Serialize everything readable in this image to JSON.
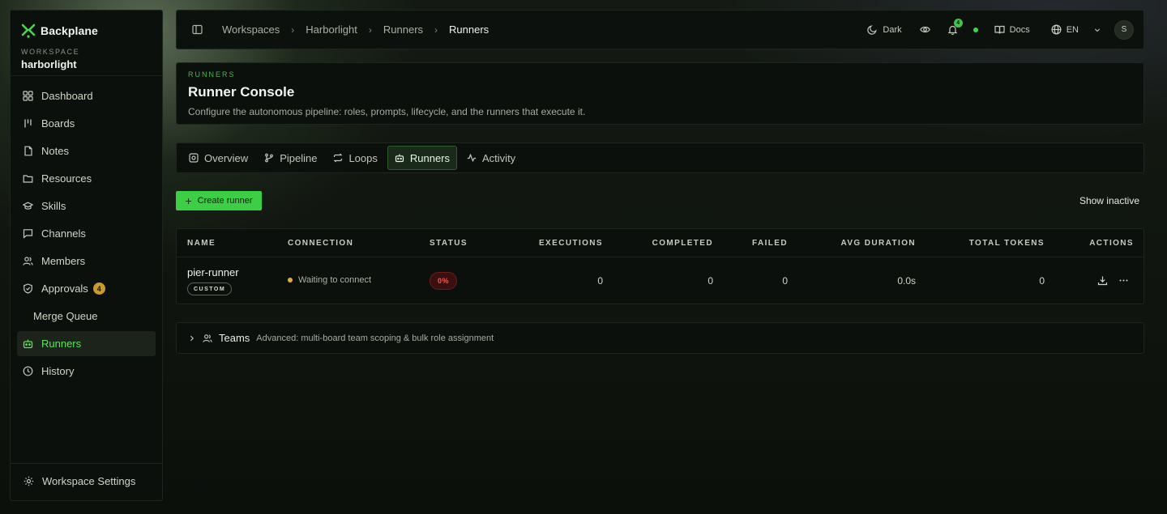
{
  "brand": {
    "name": "Backplane"
  },
  "workspace": {
    "caption": "WORKSPACE",
    "name": "harborlight"
  },
  "sidebar": {
    "items": [
      {
        "label": "Dashboard",
        "icon": "dashboard-icon"
      },
      {
        "label": "Boards",
        "icon": "boards-icon"
      },
      {
        "label": "Notes",
        "icon": "notes-icon"
      },
      {
        "label": "Resources",
        "icon": "folder-icon"
      },
      {
        "label": "Skills",
        "icon": "graduation-cap-icon"
      },
      {
        "label": "Channels",
        "icon": "chat-icon"
      },
      {
        "label": "Members",
        "icon": "users-icon"
      },
      {
        "label": "Approvals",
        "icon": "shield-icon",
        "badge": "4"
      },
      {
        "label": "Merge Queue",
        "icon": "merge-icon"
      },
      {
        "label": "Runners",
        "icon": "bot-icon",
        "active": true
      },
      {
        "label": "History",
        "icon": "clock-icon"
      }
    ],
    "settings_label": "Workspace Settings"
  },
  "breadcrumb": [
    "Workspaces",
    "Harborlight",
    "Runners",
    "Runners"
  ],
  "topbar": {
    "theme_label": "Dark",
    "notification_count": "4",
    "docs_label": "Docs",
    "language_label": "EN",
    "avatar_initial": "S"
  },
  "header": {
    "eyebrow": "RUNNERS",
    "title": "Runner Console",
    "description": "Configure the autonomous pipeline: roles, prompts, lifecycle, and the runners that execute it."
  },
  "tabs": [
    {
      "label": "Overview",
      "icon": "overview-icon"
    },
    {
      "label": "Pipeline",
      "icon": "git-branch-icon"
    },
    {
      "label": "Loops",
      "icon": "loop-icon"
    },
    {
      "label": "Runners",
      "icon": "bot-icon",
      "active": true
    },
    {
      "label": "Activity",
      "icon": "activity-icon"
    }
  ],
  "actions": {
    "create_label": "Create runner",
    "show_inactive_label": "Show inactive"
  },
  "table": {
    "columns": [
      "NAME",
      "CONNECTION",
      "STATUS",
      "EXECUTIONS",
      "COMPLETED",
      "FAILED",
      "AVG DURATION",
      "TOTAL TOKENS",
      "ACTIONS"
    ],
    "rows": [
      {
        "name": "pier-runner",
        "tag": "CUSTOM",
        "connection": "Waiting to connect",
        "status": "0%",
        "executions": "0",
        "completed": "0",
        "failed": "0",
        "avg_duration": "0.0s",
        "total_tokens": "0"
      }
    ]
  },
  "teams": {
    "title": "Teams",
    "description": "Advanced: multi-board team scoping & bulk role assignment"
  },
  "colors": {
    "accent": "#3ccf45",
    "status_danger": "#f05a52",
    "connection_waiting": "#e0b23c",
    "badge": "#c99a2e"
  }
}
